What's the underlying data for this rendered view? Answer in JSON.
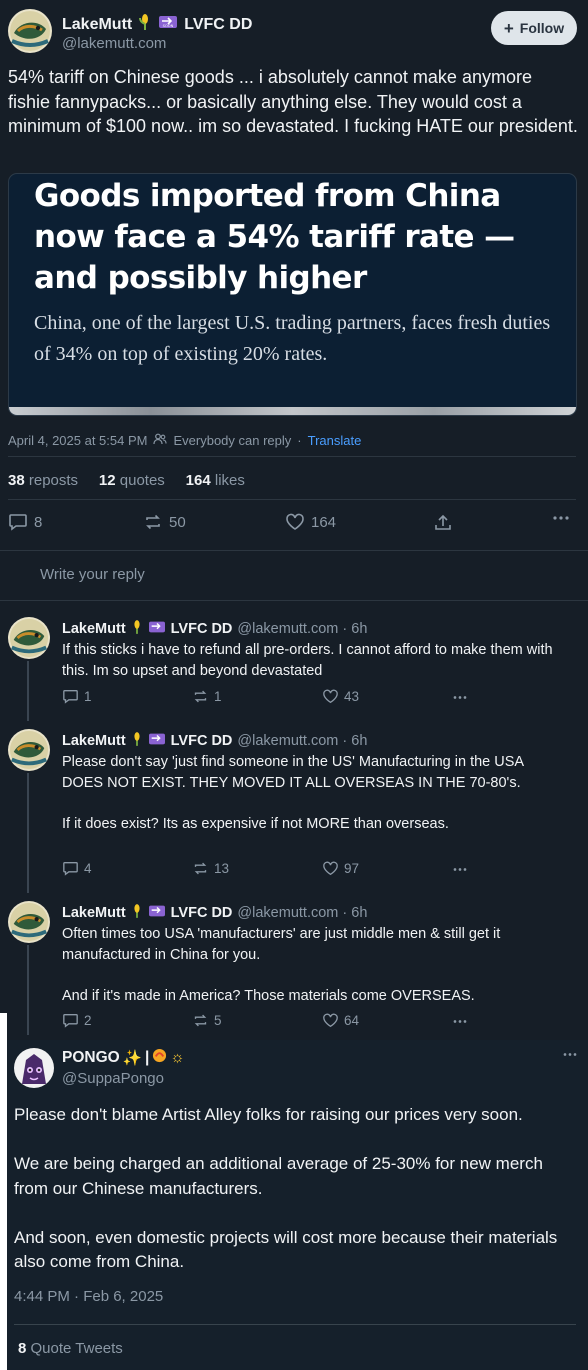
{
  "post": {
    "author_name": "LakeMutt",
    "author_suffix": "LVFC DD",
    "handle": "@lakemutt.com",
    "follow_label": "Follow",
    "text": "54% tariff on Chinese goods ... i absolutely cannot make anymore fishie fannypacks... or basically anything else. They would cost a minimum of $100 now.. im so devastated. I fucking HATE our president.",
    "card": {
      "headline": "Goods imported from China now face a 54% tariff rate — and possibly higher",
      "subhead": "China, one of the largest U.S. trading partners, faces fresh duties of 34% on top of existing 20% rates."
    },
    "timestamp": "April 4, 2025 at 5:54 PM",
    "reply_setting": "Everybody can reply",
    "translate": "Translate",
    "reposts_count": "38",
    "reposts_label": "reposts",
    "quotes_count": "12",
    "quotes_label": "quotes",
    "likes_count": "164",
    "likes_label": "likes",
    "actions": {
      "replies": "8",
      "reposts": "50",
      "likes": "164"
    }
  },
  "reply_placeholder": "Write your reply",
  "replies": [
    {
      "name": "LakeMutt",
      "suffix": "LVFC DD",
      "handle": "@lakemutt.com · 6h",
      "text": "If this sticks i have to refund all pre-orders. I cannot afford to make them with this. Im so upset and beyond devastated",
      "replies": "1",
      "reposts": "1",
      "likes": "43"
    },
    {
      "name": "LakeMutt",
      "suffix": "LVFC DD",
      "handle": "@lakemutt.com · 6h",
      "text": "Please don't say 'just find someone in the US' Manufacturing in the USA DOES NOT EXIST. THEY MOVED IT ALL OVERSEAS IN THE 70-80's.\n\nIf it does exist? Its as expensive if not MORE than overseas.",
      "replies": "4",
      "reposts": "13",
      "likes": "97"
    },
    {
      "name": "LakeMutt",
      "suffix": "LVFC DD",
      "handle": "@lakemutt.com · 6h",
      "text": "Often times too USA 'manufacturers' are just middle men & still get it manufactured in China for you.\n\nAnd if it's made in America? Those materials come OVERSEAS.",
      "replies": "2",
      "reposts": "5",
      "likes": "64"
    }
  ],
  "quoted": {
    "name": "PONGO",
    "handle": "@SuppaPongo",
    "text": "Please don't blame Artist Alley folks for raising our prices very soon.\n\nWe are being charged an additional average of 25-30% for new merch from our Chinese manufacturers.\n\nAnd soon, even domestic projects will cost more because their materials also come from China.",
    "time": "4:44 PM · Feb 6, 2025",
    "quote_count": "8",
    "quote_label": "Quote Tweets"
  },
  "colors": {
    "accent": "#4a9eff",
    "background": "#161e27",
    "muted": "#8b98a5"
  }
}
